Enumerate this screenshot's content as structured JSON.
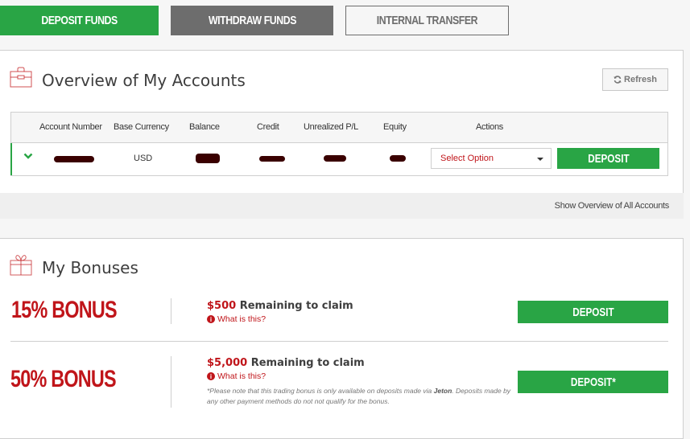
{
  "topbar": {
    "deposit_funds": "DEPOSIT FUNDS",
    "withdraw_funds": "WITHDRAW FUNDS",
    "internal_transfer": "INTERNAL TRANSFER"
  },
  "overview": {
    "icon": "briefcase-icon",
    "title": "Overview of My Accounts",
    "refresh_label": "Refresh",
    "refresh_icon": "refresh-icon",
    "columns": [
      "Account Number",
      "Base Currency",
      "Balance",
      "Credit",
      "Unrealized P/L",
      "Equity",
      "Actions"
    ],
    "rows": [
      {
        "account_number": "[redacted]",
        "base_currency": "USD",
        "balance": "[redacted]",
        "credit": "[redacted]",
        "unrealized_pl": "[redacted]",
        "equity": "[redacted]",
        "action_select": "Select Option",
        "deposit_label": "DEPOSIT"
      }
    ],
    "show_all_label": "Show Overview of All Accounts"
  },
  "bonuses": {
    "icon": "gift-icon",
    "title": "My Bonuses",
    "items": [
      {
        "name": "15% BONUS",
        "amount": "$500",
        "remaining_text": "Remaining to claim",
        "what_label": "What is this?",
        "deposit_label": "DEPOSIT"
      },
      {
        "name": "50% BONUS",
        "amount": "$5,000",
        "remaining_text": "Remaining to claim",
        "what_label": "What is this?",
        "note_prefix": "*Please note that this trading bonus is only available on deposits made via ",
        "note_method": "Jeton",
        "note_suffix": ". Deposits made by any other payment methods do not not qualify for the bonus.",
        "deposit_label": "DEPOSIT*"
      }
    ]
  },
  "colors": {
    "green": "#29a545",
    "gray": "#6d6d6d",
    "red": "#c0151a"
  }
}
